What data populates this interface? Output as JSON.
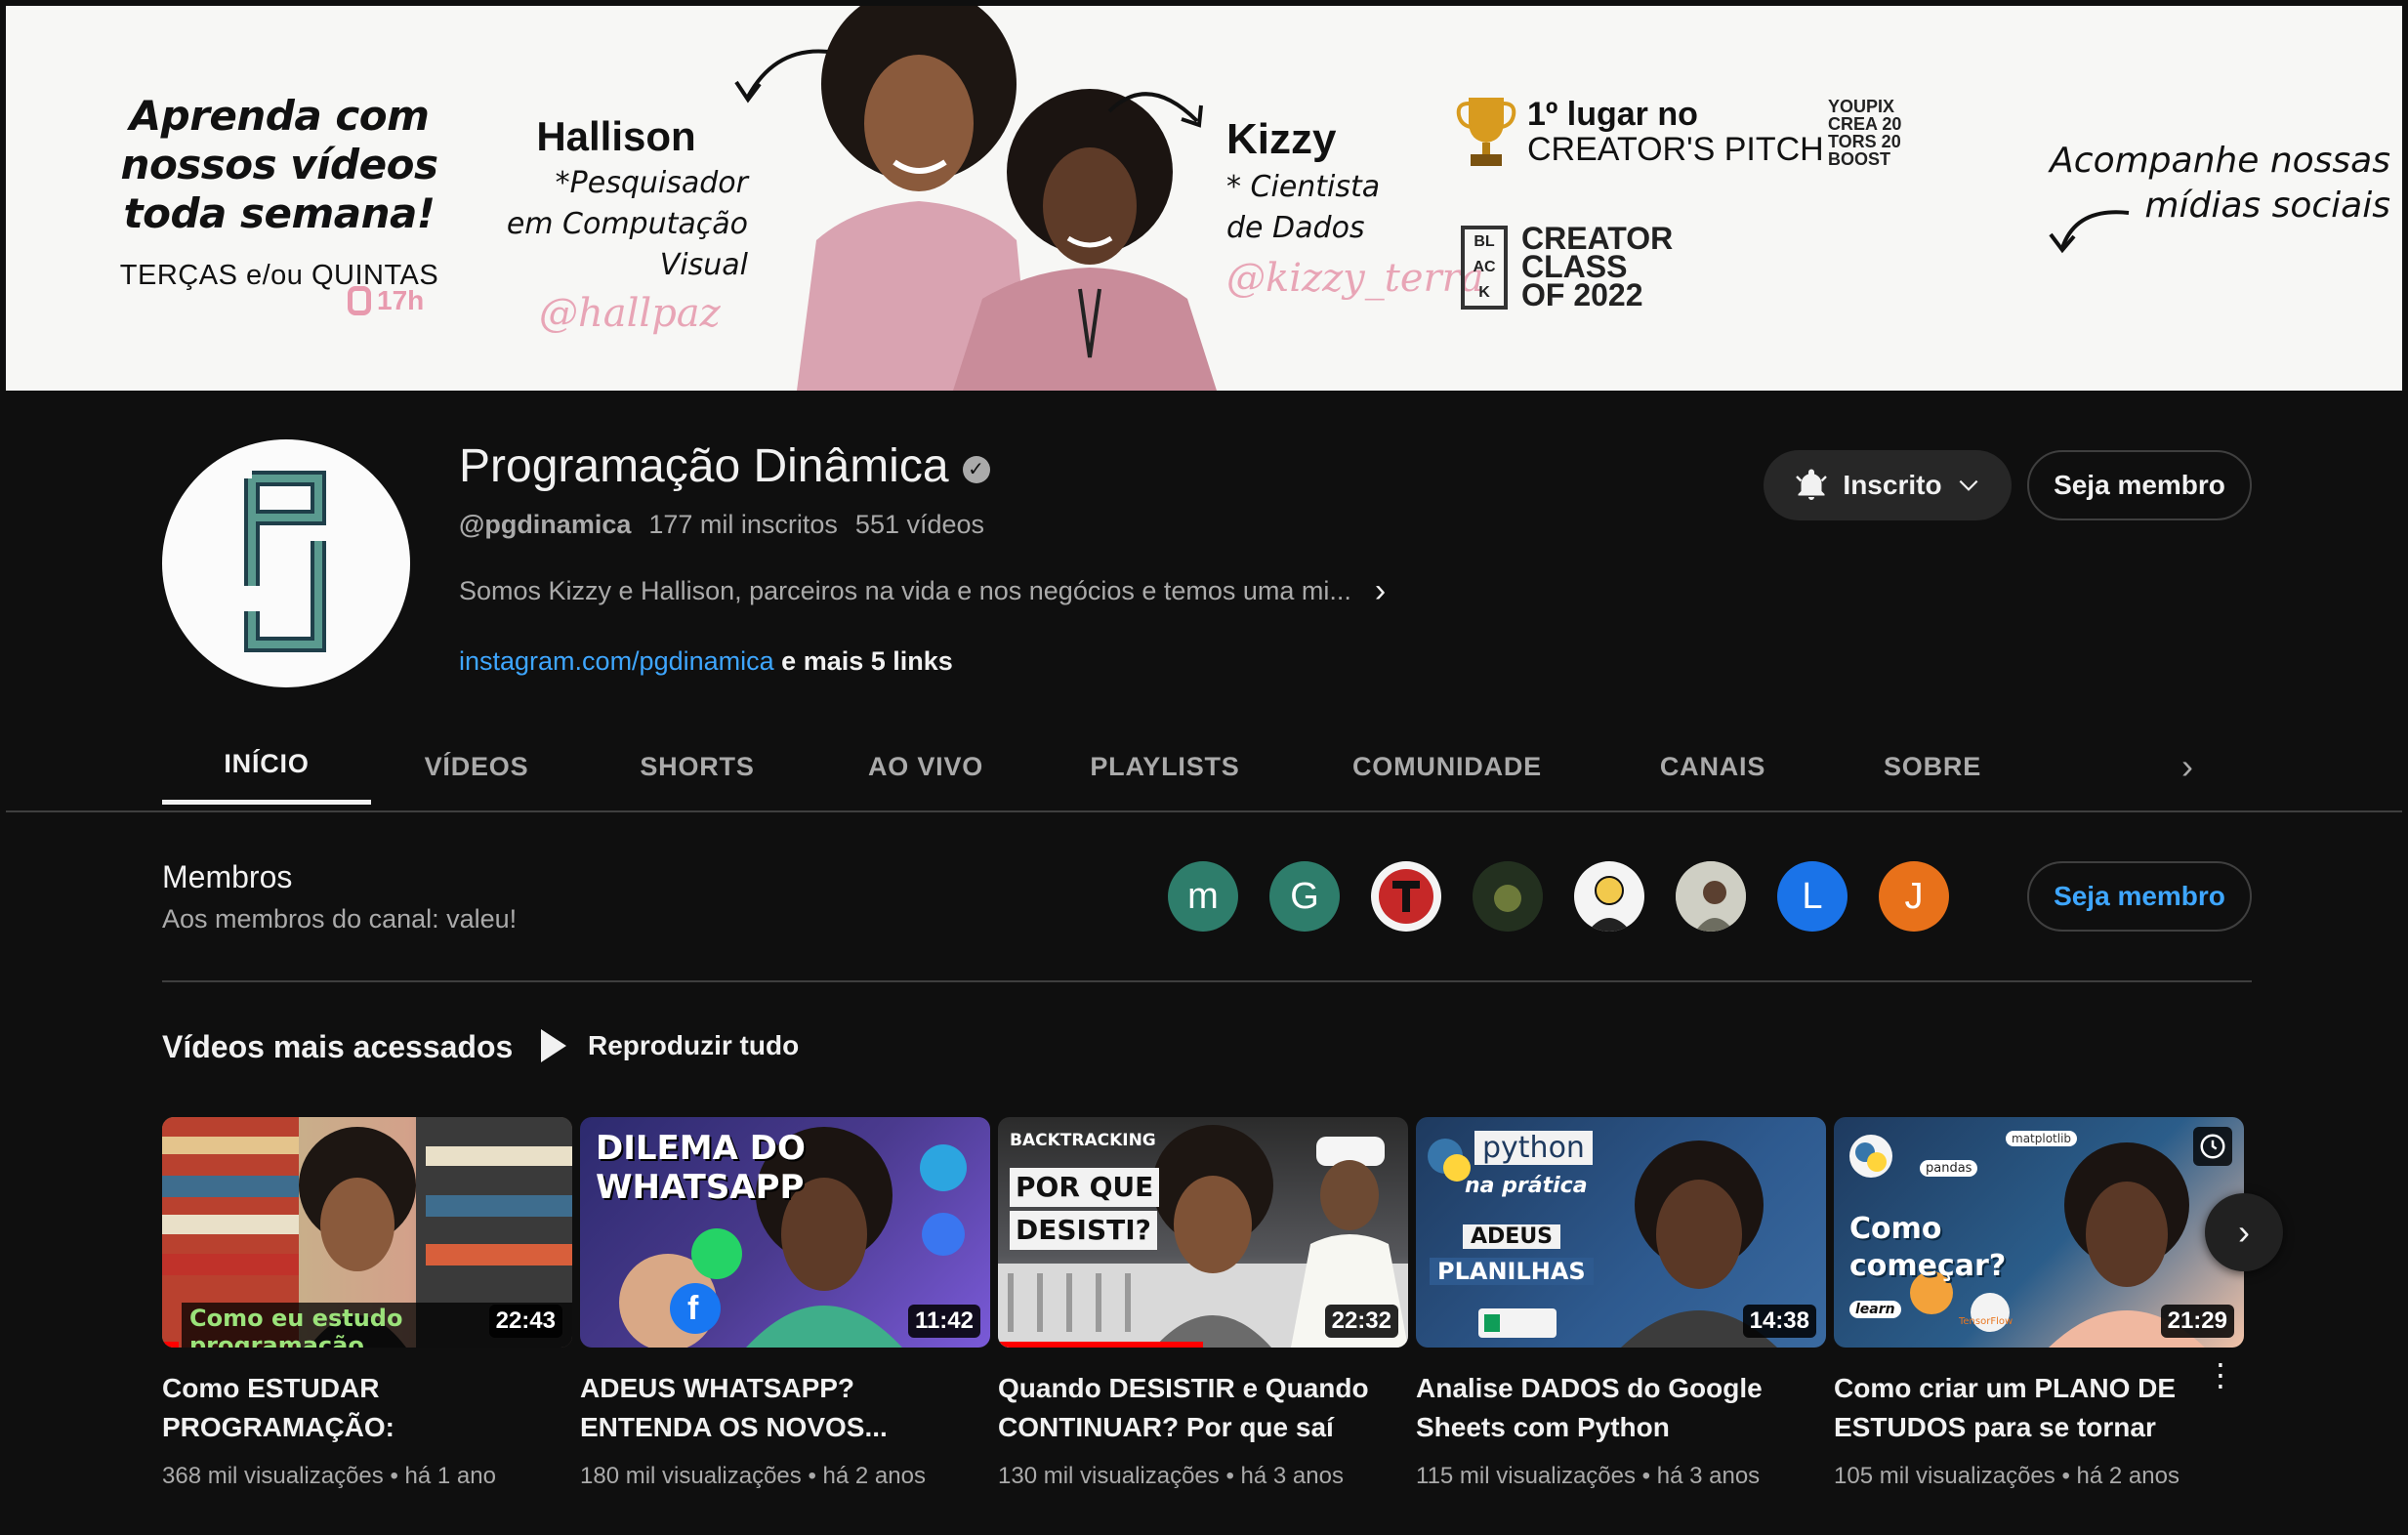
{
  "banner": {
    "left_line1": "Aprenda com",
    "left_line2": "nossos vídeos",
    "left_line3": "toda semana!",
    "days": "TERÇAS e/ou QUINTAS",
    "hour": "17h",
    "hallison_name": "Hallison",
    "hallison_role1": "*Pesquisador",
    "hallison_role2": "em Computação",
    "hallison_role3": "Visual",
    "hallison_handle": "@hallpaz",
    "kizzy_name": "Kizzy",
    "kizzy_role1": "* Cientista",
    "kizzy_role2": "de Dados",
    "kizzy_handle": "@kizzy_terra",
    "award_line1": "1º lugar no",
    "award_line2": "CREATOR'S PITCH",
    "youpix": [
      "YOUPIX",
      "CREA 20",
      "TORS 20",
      "BOOST"
    ],
    "class_block": [
      "BL",
      "AC",
      "K"
    ],
    "class_line1": "CREATOR",
    "class_line2": "CLASS",
    "class_line3": "OF 2022",
    "social_line1": "Acompanhe nossas",
    "social_line2": "mídias sociais",
    "colors": {
      "accent_pink": "#e89aae",
      "background": "#f7f7f5"
    }
  },
  "channel": {
    "title": "Programação Dinâmica",
    "verified_icon": "check-circle-icon",
    "handle": "@pgdinamica",
    "subscribers": "177 mil inscritos",
    "videos": "551 vídeos",
    "description": "Somos Kizzy e Hallison, parceiros na vida e nos negócios e temos uma mi...",
    "link": "instagram.com/pgdinamica",
    "more_links": "e mais 5 links",
    "subscribed_label": "Inscrito",
    "member_label": "Seja membro"
  },
  "tabs": [
    "INÍCIO",
    "VÍDEOS",
    "SHORTS",
    "AO VIVO",
    "PLAYLISTS",
    "COMUNIDADE",
    "CANAIS",
    "SOBRE"
  ],
  "members": {
    "title": "Membros",
    "subtitle": "Aos membros do canal: valeu!",
    "avatars": [
      {
        "letter": "m",
        "color": "#2e7d6b"
      },
      {
        "letter": "G",
        "color": "#2e7d6b"
      },
      {
        "letter": "",
        "color": "#f4f4f4"
      },
      {
        "letter": "",
        "color": "#1e2a22"
      },
      {
        "letter": "",
        "color": "#f4f4f4"
      },
      {
        "letter": "",
        "color": "#8a8a80"
      },
      {
        "letter": "L",
        "color": "#1a73e8"
      },
      {
        "letter": "J",
        "color": "#e8711a"
      }
    ],
    "member_button": "Seja membro"
  },
  "section": {
    "title": "Vídeos mais acessados",
    "play_all": "Reproduzir tudo"
  },
  "videos": [
    {
      "title": "Como ESTUDAR PROGRAMAÇÃO: Engenheir...",
      "views": "368 mil visualizações",
      "age": "há 1 ano",
      "duration": "22:43",
      "thumb_text": "Como eu estudo programação",
      "progress": 0.04
    },
    {
      "title": "ADEUS WHATSAPP? ENTENDA OS NOVOS...",
      "views": "180 mil visualizações",
      "age": "há 2 anos",
      "duration": "11:42",
      "thumb_text1": "DILEMA DO",
      "thumb_text2": "WHATSAPP",
      "progress": 0.0
    },
    {
      "title": "Quando DESISTIR e Quando CONTINUAR? Por que saí d...",
      "views": "130 mil visualizações",
      "age": "há 3 anos",
      "duration": "22:32",
      "thumb_text0": "BACKTRACKING",
      "thumb_text1": "POR QUE",
      "thumb_text2": "DESISTI?",
      "progress": 0.5
    },
    {
      "title": "Analise DADOS do Google Sheets com Python usando...",
      "views": "115 mil visualizações",
      "age": "há 3 anos",
      "duration": "14:38",
      "thumb_text0": "python",
      "thumb_text1": "na prática",
      "thumb_text2": "ADEUS",
      "thumb_text3": "PLANILHAS",
      "progress": 0.0
    },
    {
      "title": "Como criar um PLANO DE ESTUDOS para se tornar um...",
      "views": "105 mil visualizações",
      "age": "há 2 anos",
      "duration": "21:29",
      "thumb_text1": "Como",
      "thumb_text2": "começar?",
      "thumb_labels": [
        "matplotlib",
        "pandas",
        "learn",
        "TensorFlow"
      ],
      "progress": 0.0
    }
  ]
}
